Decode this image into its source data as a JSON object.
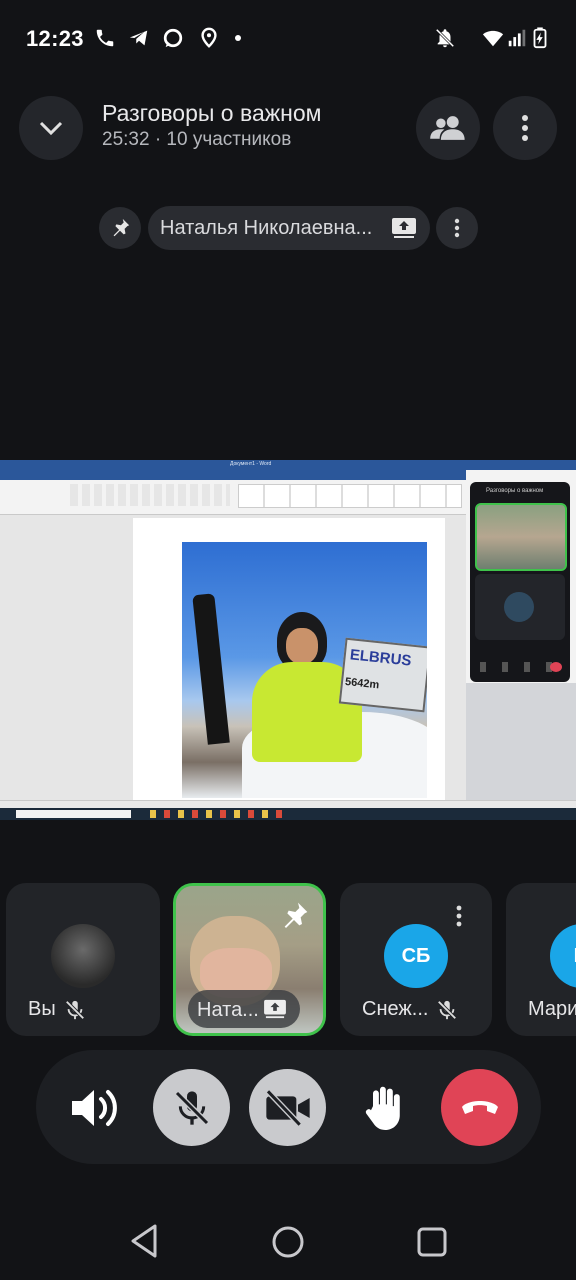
{
  "status_bar": {
    "time": "12:23"
  },
  "header": {
    "title": "Разговоры о важном",
    "subtitle": "25:32 · 10 участников"
  },
  "pinned": {
    "name": "Наталья Николаевна..."
  },
  "screen_share": {
    "app_title": "Документ1 - Word",
    "mini_call_title": "Разговоры о важном",
    "sign_text": "ELBRUS",
    "sign_altitude": "5642m"
  },
  "participants": [
    {
      "name": "Вы",
      "muted": true
    },
    {
      "name": "Ната...",
      "pinned": true,
      "sharing": true
    },
    {
      "name": "Снеж...",
      "initials": "СБ",
      "muted": true
    },
    {
      "name": "Мари",
      "initials": "М"
    }
  ],
  "colors": {
    "background": "#121316",
    "active_speaker_border": "#3fc24b",
    "end_call": "#e04456",
    "avatar_blue": "#1aa6e8"
  }
}
